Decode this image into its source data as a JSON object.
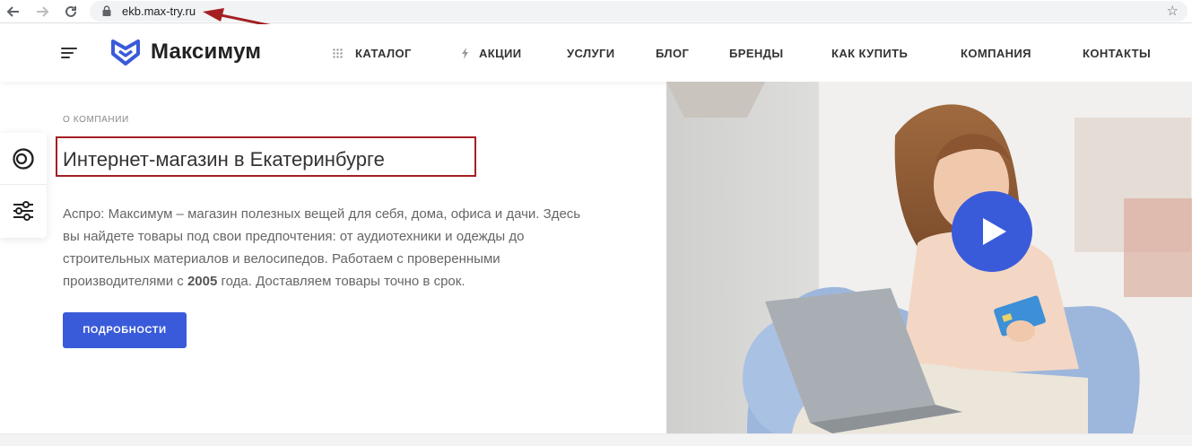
{
  "browser": {
    "url": "ekb.max-try.ru",
    "icons": [
      "back-arrow-icon",
      "forward-arrow-icon",
      "reload-icon",
      "lock-icon",
      "star-icon"
    ]
  },
  "header": {
    "logo_text": "Максимум",
    "menu": [
      {
        "label": "КАТАЛОГ",
        "icon": "grid-dots-icon"
      },
      {
        "label": "АКЦИИ",
        "icon": "lightning-icon"
      },
      {
        "label": "УСЛУГИ"
      },
      {
        "label": "БЛОГ"
      },
      {
        "label": "БРЕНДЫ"
      },
      {
        "label": "КАК КУПИТЬ"
      },
      {
        "label": "КОМПАНИЯ"
      },
      {
        "label": "КОНТАКТЫ"
      }
    ]
  },
  "side_panel": {
    "icons": [
      "compare-circles-icon",
      "filter-sliders-icon"
    ]
  },
  "about": {
    "eyebrow": "О КОМПАНИИ",
    "title": "Интернет-магазин в Екатеринбурге",
    "description_part1": "Аспро: Максимум – магазин полезных вещей для себя, дома, офиса и дачи. Здесь вы найдете товары под свои предпочтения: от аудиотехники и одежды до строительных материалов и велосипедов. Работаем с проверенными производителями с ",
    "description_bold": "2005",
    "description_part2": " года. Доставляем товары точно в срок.",
    "button_label": "ПОДРОБНОСТИ"
  },
  "colors": {
    "accent": "#3a5bd9",
    "annotation": "#a51f22",
    "text_dark": "#333333"
  }
}
